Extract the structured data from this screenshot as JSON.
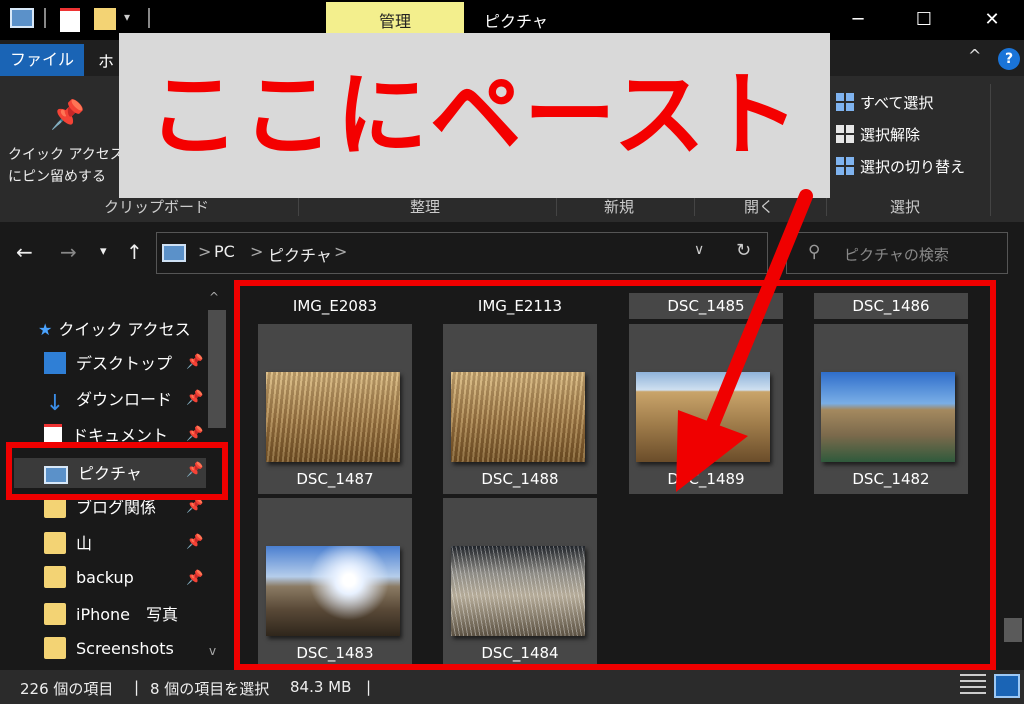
{
  "window": {
    "title": "ピクチャ",
    "context_tab": "管理",
    "minimize": "─",
    "maximize": "☐",
    "close": "✕"
  },
  "ribbon": {
    "tabs": {
      "file": "ファイル",
      "home": "ホ"
    },
    "help": "?",
    "collapse": "^",
    "clipboard": {
      "pin_label": "クイック アクセス\nにピン留めする",
      "group_label": "クリップボード"
    },
    "groups": {
      "organize": "整理",
      "new": "新規",
      "open": "開く",
      "select": "選択"
    },
    "select": {
      "select_all": "すべて選択",
      "select_none": "選択解除",
      "invert": "選択の切り替え"
    }
  },
  "overlay": {
    "banner_text": "ここにペースト",
    "banner_color": "#f40000",
    "highlight_color": "#f00000"
  },
  "address": {
    "crumbs": [
      "PC",
      "ピクチャ"
    ],
    "separator": ">",
    "search_placeholder": "ピクチャの検索"
  },
  "nav_pane": {
    "quick_access": "クイック アクセス",
    "items": [
      {
        "label": "デスクトップ"
      },
      {
        "label": "ダウンロード"
      },
      {
        "label": "ドキュメント"
      },
      {
        "label": "ピクチャ"
      },
      {
        "label": "ブログ関係"
      },
      {
        "label": "山"
      },
      {
        "label": "backup"
      },
      {
        "label": "iPhone　写真"
      },
      {
        "label": "Screenshots"
      }
    ]
  },
  "content": {
    "header_items": [
      "IMG_E2083",
      "IMG_E2113",
      "DSC_1485",
      "DSC_1486"
    ],
    "files": [
      "DSC_1487",
      "DSC_1488",
      "DSC_1489",
      "DSC_1482",
      "DSC_1483",
      "DSC_1484"
    ]
  },
  "status": {
    "item_count": "226 個の項目",
    "selection": "8 個の項目を選択",
    "size": "84.3 MB"
  }
}
